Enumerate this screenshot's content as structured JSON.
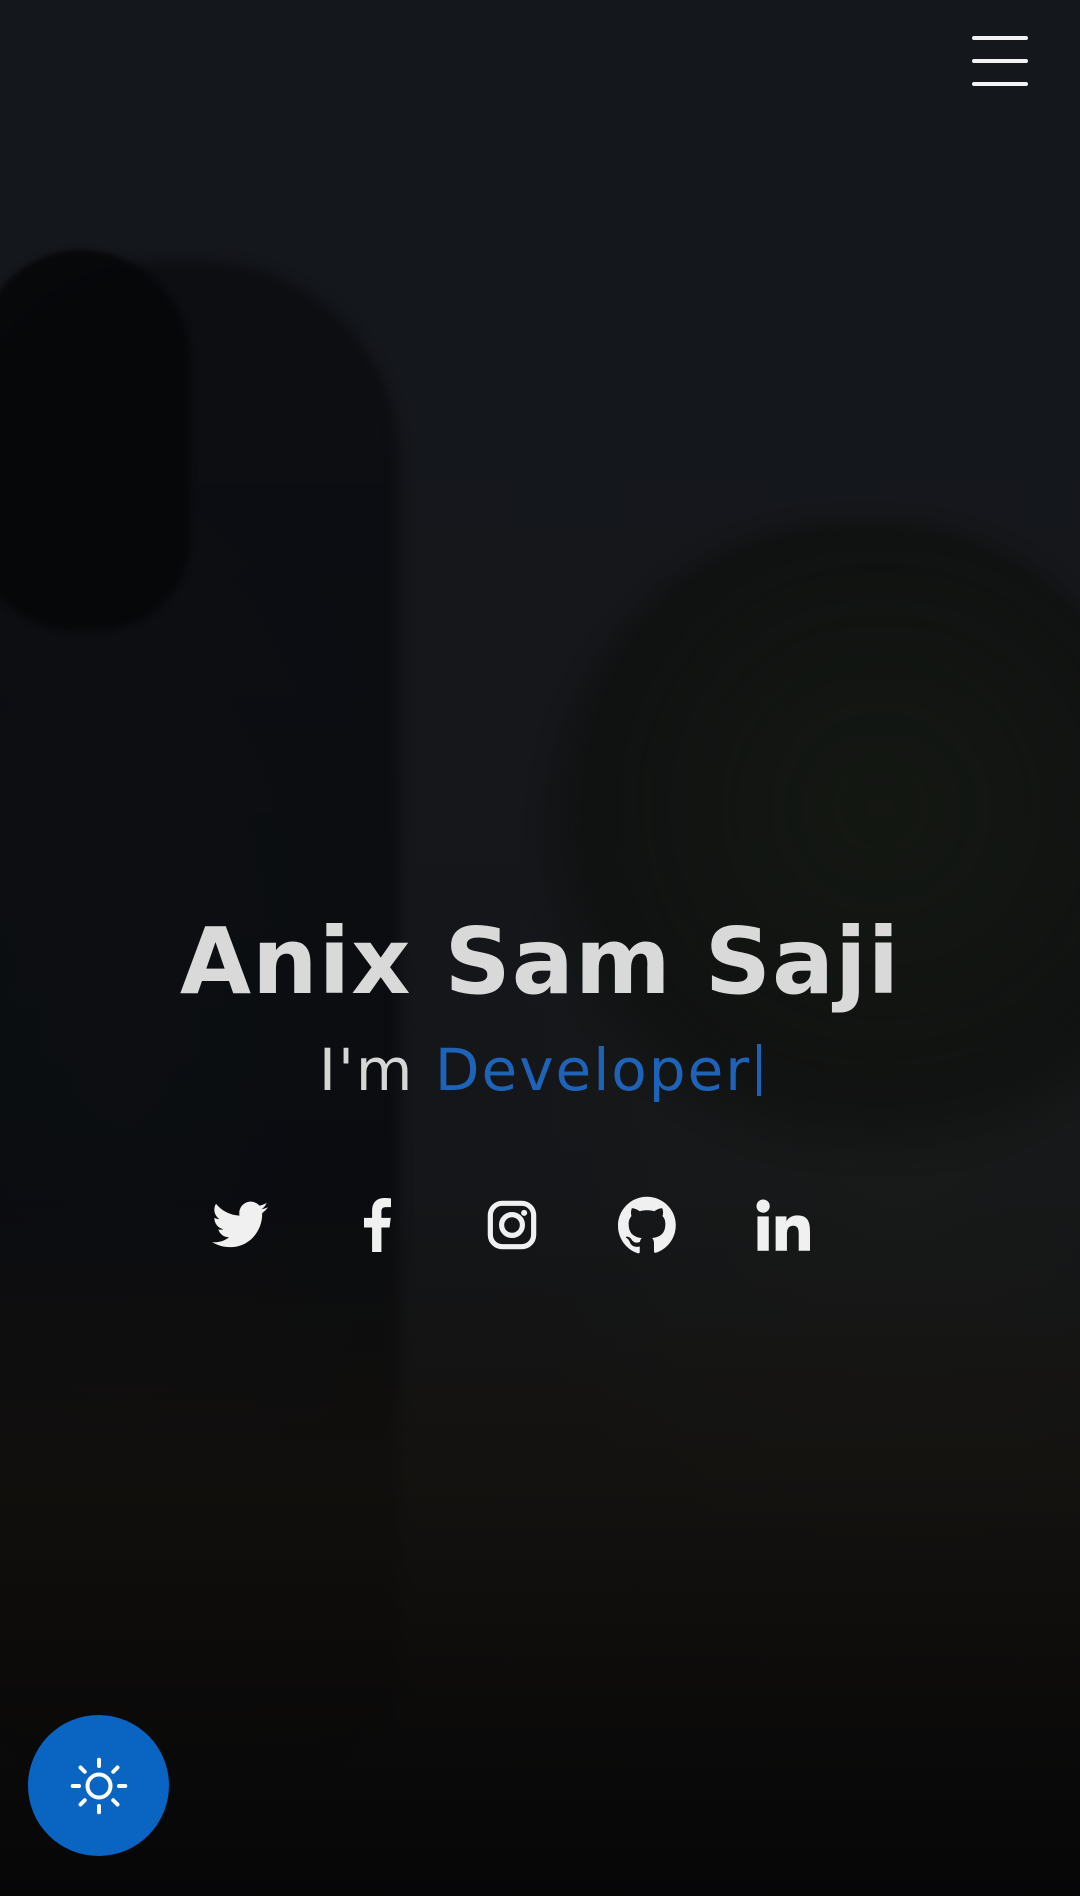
{
  "hero": {
    "name": "Anix Sam Saji",
    "intro_prefix": "I'm",
    "intro_role": "Developer",
    "role_color": "#1f63b9"
  },
  "nav": {
    "menu_icon": "hamburger-menu-icon"
  },
  "socials": [
    {
      "name": "twitter",
      "icon": "twitter-icon"
    },
    {
      "name": "facebook",
      "icon": "facebook-icon"
    },
    {
      "name": "instagram",
      "icon": "instagram-icon"
    },
    {
      "name": "github",
      "icon": "github-icon"
    },
    {
      "name": "linkedin",
      "icon": "linkedin-icon"
    }
  ],
  "theme_toggle": {
    "icon": "sun-icon",
    "color": "#0a64c2"
  }
}
